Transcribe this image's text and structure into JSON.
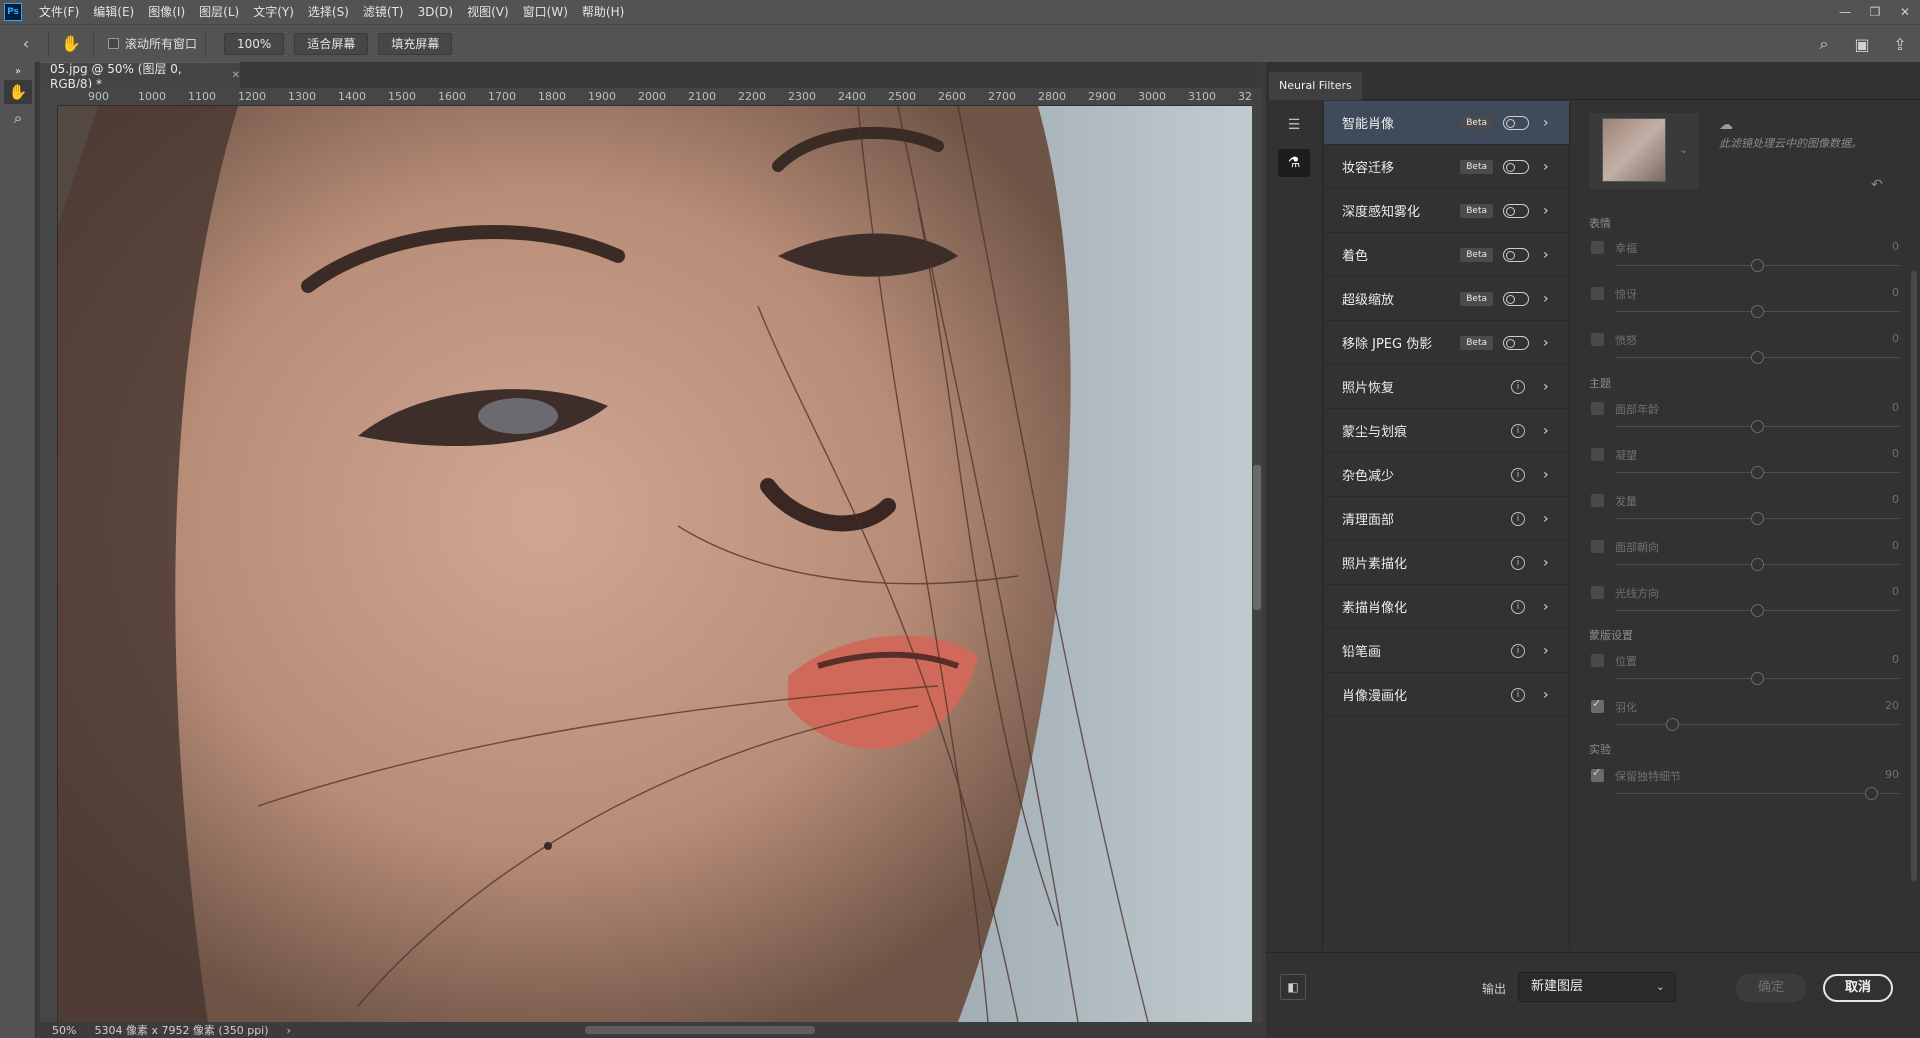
{
  "app": {
    "logo": "Ps"
  },
  "menu": [
    "文件(F)",
    "编辑(E)",
    "图像(I)",
    "图层(L)",
    "文字(Y)",
    "选择(S)",
    "滤镜(T)",
    "3D(D)",
    "视图(V)",
    "窗口(W)",
    "帮助(H)"
  ],
  "options": {
    "scroll_all_label": "滚动所有窗口",
    "zoom_value": "100%",
    "fit_screen_label": "适合屏幕",
    "fill_screen_label": "填充屏幕"
  },
  "document": {
    "tab_title": "05.jpg @ 50% (图层 0, RGB/8) *",
    "ruler_ticks": [
      "900",
      "1000",
      "1100",
      "1200",
      "1300",
      "1400",
      "1500",
      "1600",
      "1700",
      "1800",
      "1900",
      "2000",
      "2100",
      "2200",
      "2300",
      "2400",
      "2500",
      "2600",
      "2700",
      "2800",
      "2900",
      "3000",
      "3100",
      "32"
    ],
    "status_zoom": "50%",
    "status_info": "5304 像素 x 7952 像素 (350 ppi)"
  },
  "neural_filters": {
    "panel_title": "Neural Filters",
    "beta_label": "Beta",
    "filters": [
      {
        "label": "智能肖像",
        "kind": "beta",
        "selected": true
      },
      {
        "label": "妆容迁移",
        "kind": "beta"
      },
      {
        "label": "深度感知雾化",
        "kind": "beta"
      },
      {
        "label": "着色",
        "kind": "beta"
      },
      {
        "label": "超级缩放",
        "kind": "beta"
      },
      {
        "label": "移除 JPEG 伪影",
        "kind": "beta"
      },
      {
        "label": "照片恢复",
        "kind": "info"
      },
      {
        "label": "蒙尘与划痕",
        "kind": "info"
      },
      {
        "label": "杂色减少",
        "kind": "info"
      },
      {
        "label": "清理面部",
        "kind": "info"
      },
      {
        "label": "照片素描化",
        "kind": "info"
      },
      {
        "label": "素描肖像化",
        "kind": "info"
      },
      {
        "label": "铅笔画",
        "kind": "info"
      },
      {
        "label": "肖像漫画化",
        "kind": "info"
      }
    ],
    "cloud_note": "此滤镜处理云中的图像数据。",
    "sections": {
      "expression": "表情",
      "theme": "主题",
      "mask": "蒙版设置",
      "experimental": "实验"
    },
    "sliders": [
      {
        "label": "幸福",
        "value": "0",
        "level": 0.5,
        "checked": false
      },
      {
        "label": "惊讶",
        "value": "0",
        "level": 0.5,
        "checked": false
      },
      {
        "label": "愤怒",
        "value": "0",
        "level": 0.5,
        "checked": false
      },
      {
        "label": "面部年龄",
        "value": "0",
        "level": 0.5,
        "checked": false
      },
      {
        "label": "凝望",
        "value": "0",
        "level": 0.5,
        "checked": false
      },
      {
        "label": "发量",
        "value": "0",
        "level": 0.5,
        "checked": false
      },
      {
        "label": "面部朝向",
        "value": "0",
        "level": 0.5,
        "checked": false
      },
      {
        "label": "光线方向",
        "value": "0",
        "level": 0.5,
        "checked": false
      },
      {
        "label": "位置",
        "value": "0",
        "level": 0.5,
        "checked": false
      },
      {
        "label": "羽化",
        "value": "20",
        "level": 0.2,
        "checked": true
      },
      {
        "label": "保留独特细节",
        "value": "90",
        "level": 0.9,
        "checked": true
      }
    ],
    "output_label": "输出",
    "output_value": "新建图层",
    "ok_label": "确定",
    "cancel_label": "取消"
  }
}
